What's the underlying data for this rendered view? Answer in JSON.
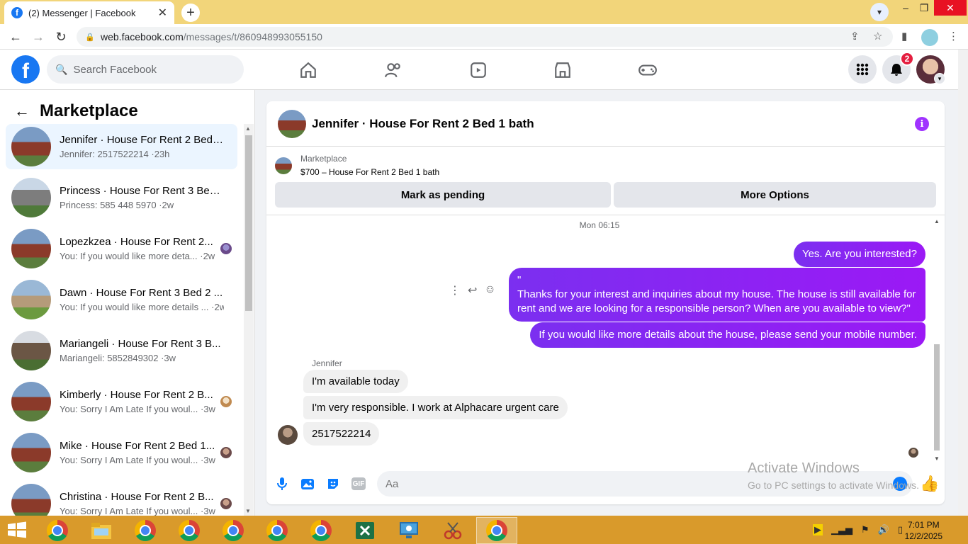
{
  "browser": {
    "tab_title": "(2) Messenger | Facebook",
    "tab_close": "✕",
    "new_tab": "+",
    "url_host": "web.facebook.com",
    "url_path": "/messages/t/860948993055150",
    "window_controls": [
      "–",
      "❐",
      "✕"
    ]
  },
  "fb": {
    "search_placeholder": "Search Facebook",
    "nav_icons": [
      "home-icon",
      "friends-icon",
      "watch-icon",
      "marketplace-icon",
      "gaming-icon"
    ],
    "notification_count": "2",
    "brand_color": "#1877f2"
  },
  "sidebar": {
    "title": "Marketplace",
    "conversations": [
      {
        "name": "Jennifer · House For Rent 2 Bed ...",
        "snippet": "Jennifer: 2517522214 ·23h",
        "active": true
      },
      {
        "name": "Princess · House For Rent 3 Bed ...",
        "snippet": "Princess: 585 448 5970 ·2w"
      },
      {
        "name": "Lopezkzea · House For Rent 2...",
        "snippet": "You: If you would like more deta... ·2w"
      },
      {
        "name": "Dawn · House For Rent 3 Bed 2 ...",
        "snippet": "You: If you would like more details ... ·2w"
      },
      {
        "name": "Mariangeli · House For Rent 3 B...",
        "snippet": "Mariangeli: 5852849302 ·3w"
      },
      {
        "name": "Kimberly · House For Rent 2 B...",
        "snippet": "You: Sorry I Am Late If you woul... ·3w"
      },
      {
        "name": "Mike · House For Rent 2 Bed 1...",
        "snippet": "You: Sorry I Am Late If you woul... ·3w"
      },
      {
        "name": "Christina · House For Rent 2 B...",
        "snippet": "You: Sorry I Am Late If you woul... ·3w"
      }
    ]
  },
  "chat": {
    "title": "Jennifer · House For Rent 2 Bed 1 bath",
    "marketplace_label": "Marketplace",
    "listing": "$700 – House For Rent 2 Bed 1 bath",
    "mark_pending": "Mark as pending",
    "more_options": "More Options",
    "timestamp": "Mon 06:15",
    "messages_out": [
      "Yes. Are you interested?",
      "\"\nThanks for your interest and inquiries about my house. The house is still available for rent and we are looking for a responsible person? When are you available to view?\"",
      "If you would like more details about the house, please send your mobile number."
    ],
    "sender_name": "Jennifer",
    "messages_in": [
      "I'm available today",
      "I'm very responsible. I work at Alphacare urgent care",
      "2517522214"
    ],
    "composer_placeholder": "Aa",
    "accent_color": "#8a2be2"
  },
  "watermark": {
    "line1": "Activate Windows",
    "line2": "Go to PC settings to activate Windows."
  },
  "taskbar": {
    "time": "7:01 PM",
    "date": "12/2/2025"
  }
}
